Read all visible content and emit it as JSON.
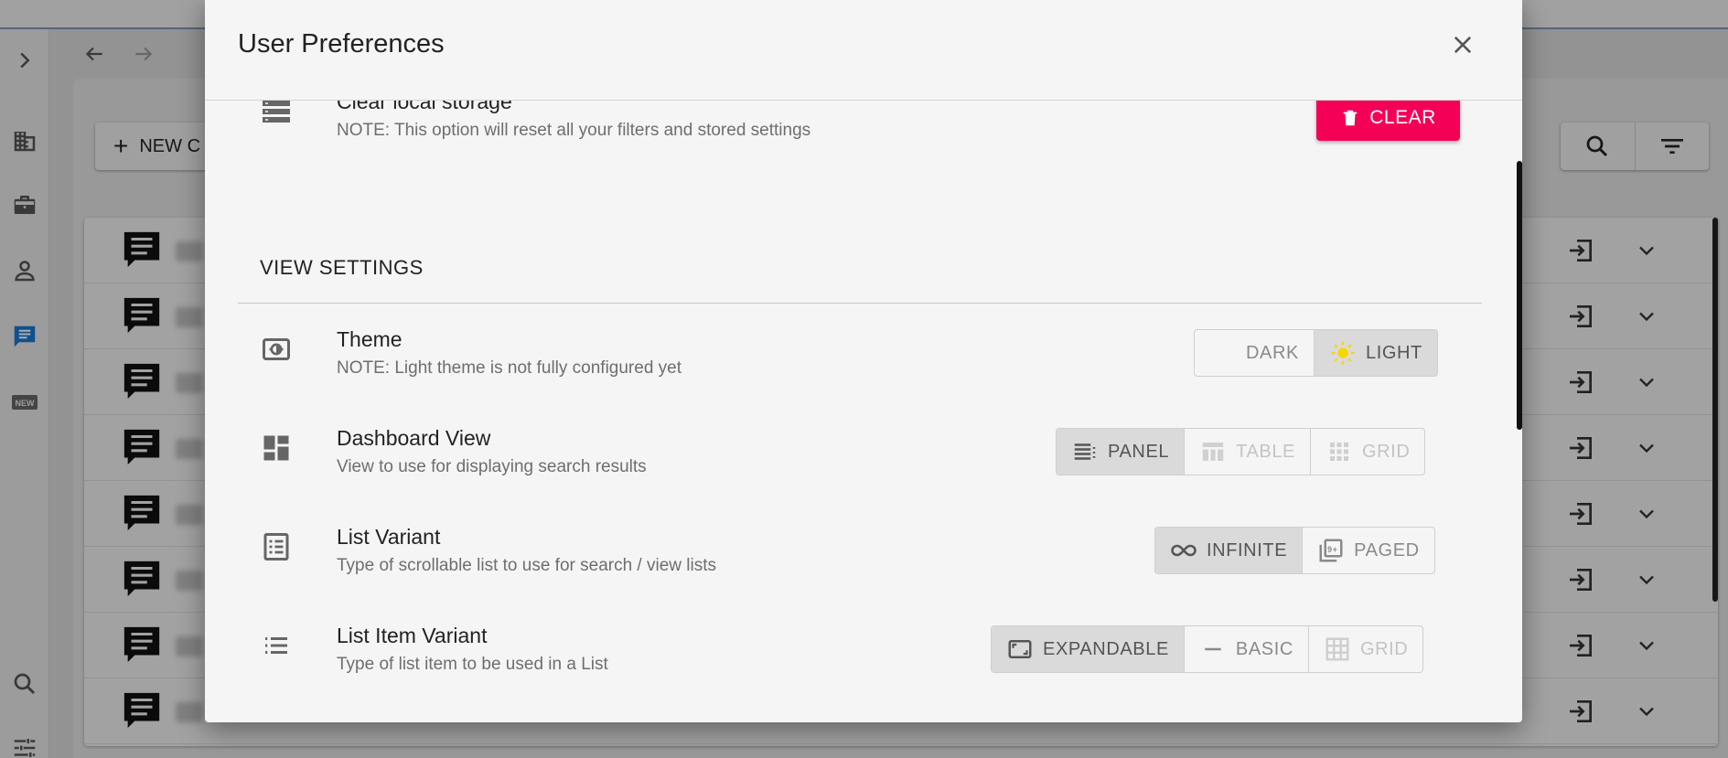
{
  "background": {
    "new_button_label": "NEW C",
    "list_row_count": 8
  },
  "dialog": {
    "title": "User Preferences",
    "storage": {
      "title": "Clear local storage",
      "description": "NOTE: This option will reset all your filters and stored settings",
      "button_label": "CLEAR"
    },
    "view_settings": {
      "heading": "VIEW SETTINGS",
      "theme": {
        "title": "Theme",
        "description": "NOTE: Light theme is not fully configured yet",
        "options": {
          "dark": "DARK",
          "light": "LIGHT"
        },
        "selected": "light"
      },
      "dashboard": {
        "title": "Dashboard View",
        "description": "View to use for displaying search results",
        "options": {
          "panel": "PANEL",
          "table": "TABLE",
          "grid": "GRID"
        },
        "selected": "panel"
      },
      "list_variant": {
        "title": "List Variant",
        "description": "Type of scrollable list to use for search / view lists",
        "options": {
          "infinite": "INFINITE",
          "paged": "PAGED"
        },
        "selected": "infinite"
      },
      "list_item_variant": {
        "title": "List Item Variant",
        "description": "Type of list item to be used in a List",
        "options": {
          "expandable": "EXPANDABLE",
          "basic": "BASIC",
          "grid": "GRID"
        },
        "selected": "expandable"
      }
    }
  },
  "colors": {
    "accent_red": "#f50057",
    "nav_active_blue": "#1976d2",
    "sun_yellow": "#f5d800",
    "moon_blue": "#2196f3"
  },
  "icons": {
    "nav": [
      "chevron-right-icon",
      "building-icon",
      "briefcase-icon",
      "person-icon",
      "chat-icon",
      "new-badge-icon",
      "search-icon",
      "tune-icon"
    ],
    "row": [
      "comment-icon",
      "enter-icon",
      "chevron-down-icon"
    ]
  }
}
